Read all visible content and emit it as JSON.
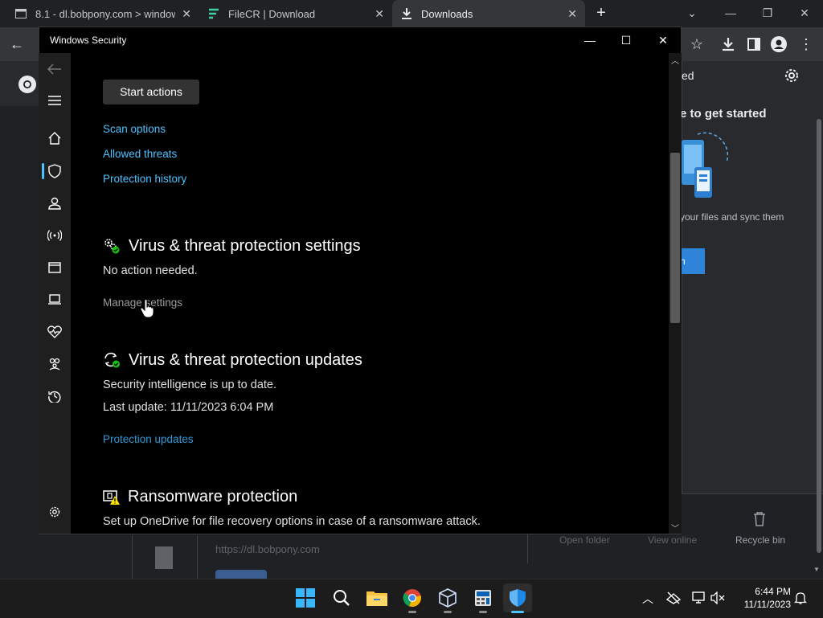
{
  "browser": {
    "tabs": [
      {
        "label": "8.1 - dl.bobpony.com > window",
        "icon": "page-icon",
        "active": false
      },
      {
        "label": "FileCR | Download",
        "icon": "filecr-icon",
        "active": false
      },
      {
        "label": "Downloads",
        "icon": "download-icon",
        "active": true
      }
    ],
    "downloads_panel": {
      "title_fragment": "ed",
      "started_fragment": "e to get started",
      "sync_fragment": "your files and sync them",
      "button_fragment": "n",
      "footer": {
        "open_folder": "Open folder",
        "view_online": "View online",
        "recycle_bin": "Recycle bin"
      },
      "row_url": "https://dl.bobpony.com"
    }
  },
  "security": {
    "window_title": "Windows Security",
    "start_actions": "Start actions",
    "links": {
      "scan_options": "Scan options",
      "allowed_threats": "Allowed threats",
      "protection_history": "Protection history"
    },
    "settings": {
      "title": "Virus & threat protection settings",
      "status": "No action needed.",
      "manage": "Manage settings"
    },
    "updates": {
      "title": "Virus & threat protection updates",
      "status": "Security intelligence is up to date.",
      "last_update": "Last update: 11/11/2023 6:04 PM",
      "link": "Protection updates"
    },
    "ransomware": {
      "title": "Ransomware protection",
      "description": "Set up OneDrive for file recovery options in case of a ransomware attack."
    }
  },
  "taskbar": {
    "time": "6:44 PM",
    "date": "11/11/2023"
  },
  "colors": {
    "accent": "#4cc2ff",
    "link": "#2e9bd6",
    "status_ok": "#16c60c",
    "status_warn": "#fce100"
  }
}
